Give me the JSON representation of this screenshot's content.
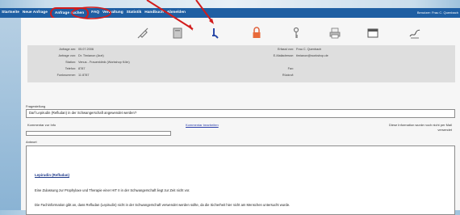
{
  "nav": {
    "items": [
      "Startseite",
      "Neue Anfrage",
      "Anfrage suchen",
      "FAQ",
      "Verwaltung",
      "Statistik",
      "Handbuch",
      "Abmelden"
    ],
    "highlighted_index": 2,
    "user": "Benutzer: Frau C. Quenbach"
  },
  "toolbar": {
    "icons": [
      "syringe-icon",
      "copy-icon",
      "bookmark-icon",
      "lock-icon",
      "key-icon",
      "printer-icon",
      "calendar-icon",
      "signature-icon"
    ]
  },
  "record": {
    "left": [
      {
        "label": "Anfrage am:",
        "value": "05.07.2006"
      },
      {
        "label": "Anfrage von:",
        "value": "Dr. Timianon (Arzt)"
      },
      {
        "label": "Station:",
        "value": "Venus - Frauenklinik (Workshop Köln)"
      },
      {
        "label": "Telefon:",
        "value": "8787"
      },
      {
        "label": "Funknummer:",
        "value": "11 8787"
      }
    ],
    "right": [
      {
        "label": "Erfasst von:",
        "value": "Frau C. Quenbach"
      },
      {
        "label": "E-Mailadresse:",
        "value": "timianon@workshop.de"
      },
      {
        "label": "",
        "value": ""
      },
      {
        "label": "Fax:",
        "value": ""
      },
      {
        "label": "Rückruf:",
        "value": ""
      }
    ]
  },
  "fragestellung": {
    "label": "Fragestellung",
    "text": "Darf Lepirudin (Refludan) in der Schwangerschaft angewendet werden?"
  },
  "kommentar": {
    "label": "Kommentar zur Info",
    "link": "Kommentar bearbeiten",
    "note_line1": "Diese Information wurde noch nicht per Mail",
    "note_line2": "versendet"
  },
  "antwort": {
    "label": "Antwort",
    "heading": "Lepirudin (Refludan)",
    "para1": "Eine Zulassung zur Prophylaxe und Therapie einer HIT II in der Schwangerschaft liegt zur Zeit nicht vor.",
    "para2": "Die Fachinformation gibt an, dass Refludan (Lepirudin) nicht in der Schwangerschaft verwendet werden sollte, da die Sicherheit hier nicht am Menschen untersucht wurde."
  },
  "colors": {
    "nav_bg": "#1f5fa3",
    "highlight": "#d21c1c"
  }
}
